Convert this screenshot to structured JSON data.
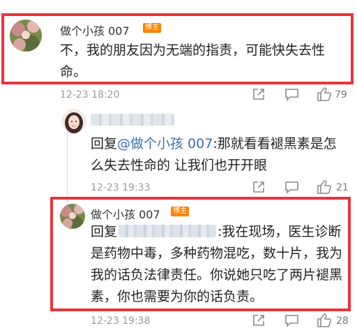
{
  "comment1": {
    "username": "做个小孩 007",
    "badge": "博主",
    "text": "不，我的朋友因为无端的指责，可能快失去性命。",
    "time": "12-23 18:20",
    "likes": "79"
  },
  "reply1": {
    "reply_prefix": "回复",
    "mention": "@做个小孩 007",
    "text": ":那就看看褪黑素是怎么失去性命的 让我们也开开眼",
    "time": "12-23 19:33",
    "likes": "21"
  },
  "reply2": {
    "username": "做个小孩 007",
    "badge": "博主",
    "reply_prefix": "回复",
    "text": ":我在现场，医生诊断是药物中毒，多种药物混吃，数十片，我为我的话负法律责任。你说她只吃了两片褪黑素，你也需要为你的话负责。",
    "time": "12-23 19:38",
    "likes": "28"
  },
  "icons": {
    "share": "share-icon",
    "comment": "comment-icon",
    "like": "thumbs-up-icon",
    "verified": "verified-v-icon"
  },
  "colors": {
    "highlight_border": "#e8343c",
    "badge": "#ff8200",
    "mention": "#3a6fb5",
    "meta_text": "#9a9a9a"
  }
}
